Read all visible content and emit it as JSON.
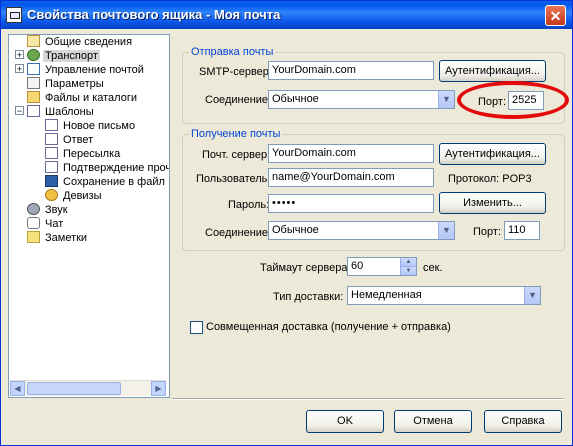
{
  "window": {
    "title": "Свойства почтового ящика - Моя почта",
    "close": "✕"
  },
  "tree": {
    "items": [
      {
        "label": "Общие сведения"
      },
      {
        "label": "Транспорт",
        "selected": true
      },
      {
        "label": "Управление почтой"
      },
      {
        "label": "Параметры"
      },
      {
        "label": "Файлы и каталоги"
      },
      {
        "label": "Шаблоны"
      },
      {
        "label": "Новое письмо"
      },
      {
        "label": "Ответ"
      },
      {
        "label": "Пересылка"
      },
      {
        "label": "Подтверждение прочт"
      },
      {
        "label": "Сохранение в файл"
      },
      {
        "label": "Девизы"
      },
      {
        "label": "Звук"
      },
      {
        "label": "Чат"
      },
      {
        "label": "Заметки"
      }
    ]
  },
  "send": {
    "group_title": "Отправка почты",
    "smtp_label": "SMTP-сервер:",
    "smtp_value": "YourDomain.com",
    "auth_button": "Аутентификация...",
    "conn_label": "Соединение:",
    "conn_value": "Обычное",
    "port_label": "Порт:",
    "port_value": "2525"
  },
  "receive": {
    "group_title": "Получение почты",
    "server_label": "Почт. сервер:",
    "server_value": "YourDomain.com",
    "auth_button": "Аутентификация...",
    "user_label": "Пользователь:",
    "user_value": "name@YourDomain.com",
    "protocol_label": "Протокол:",
    "protocol_value": "POP3",
    "pass_label": "Пароль:",
    "pass_value": "•••••",
    "change_button": "Изменить...",
    "conn_label": "Соединение:",
    "conn_value": "Обычное",
    "port_label": "Порт:",
    "port_value": "110"
  },
  "timeout": {
    "label": "Таймаут сервера:",
    "value": "60",
    "unit": "сек."
  },
  "delivery": {
    "label": "Тип доставки:",
    "value": "Немедленная"
  },
  "combined": {
    "label": "Совмещенная доставка (получение + отправка)",
    "checked": false
  },
  "buttons": {
    "ok": "OK",
    "cancel": "Отмена",
    "help": "Справка"
  },
  "colors": {
    "accent_title": "#0046d5",
    "highlight": "#e40b0b"
  }
}
